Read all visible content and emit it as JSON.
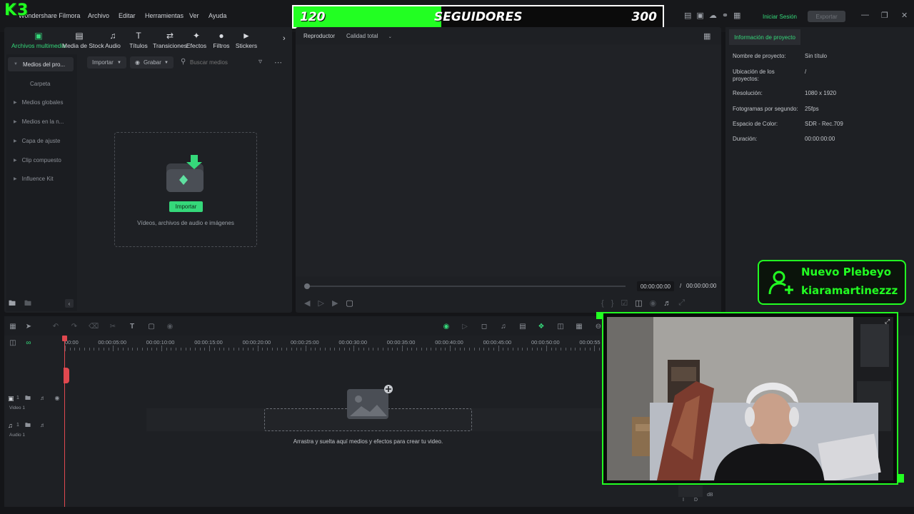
{
  "app": {
    "title": "Wondershare Filmora",
    "menu": [
      "Archivo",
      "Editar",
      "Herramientas",
      "Ver",
      "Ayuda"
    ],
    "login_label": "Iniciar Sesión",
    "export_label": "Exportar"
  },
  "overlay": {
    "logo_text": "K3",
    "followers_current": "120",
    "followers_label": "SEGUIDORES",
    "followers_goal": "300",
    "followers_progress": 0.4,
    "new_follower_title": "Nuevo Plebeyo",
    "new_follower_name": "kiaramartinezzz"
  },
  "media_tabs": [
    {
      "label": "Archivos multimedia",
      "icon": "media-icon"
    },
    {
      "label": "Media de Stock",
      "icon": "stock-icon"
    },
    {
      "label": "Audio",
      "icon": "audio-icon"
    },
    {
      "label": "Títulos",
      "icon": "titles-icon"
    },
    {
      "label": "Transiciones",
      "icon": "transitions-icon"
    },
    {
      "label": "Efectos",
      "icon": "effects-icon"
    },
    {
      "label": "Filtros",
      "icon": "filters-icon"
    },
    {
      "label": "Stickers",
      "icon": "stickers-icon"
    }
  ],
  "sidebar": {
    "items": [
      "Medios del pro...",
      "Carpeta",
      "Medios globales",
      "Medios en la n...",
      "Capa de ajuste",
      "Clip compuesto",
      "Influence Kit"
    ]
  },
  "library": {
    "import_label": "Importar",
    "record_label": "Grabar",
    "search_placeholder": "Buscar medios",
    "drop_button": "Importar",
    "drop_hint": "Vídeos, archivos de audio e imágenes"
  },
  "player": {
    "label": "Reproductor",
    "quality": "Calidad total",
    "current_time": "00:00:00:00",
    "separator": "/",
    "total_time": "00:00:00:00"
  },
  "project_info": {
    "tab": "Información de proyecto",
    "rows": [
      {
        "label": "Nombre de proyecto:",
        "value": "Sin título"
      },
      {
        "label": "Ubicación de los proyectos:",
        "value": "/"
      },
      {
        "label": "Resolución:",
        "value": "1080 x 1920"
      },
      {
        "label": "Fotogramas por segundo:",
        "value": "25fps"
      },
      {
        "label": "Espacio de Color:",
        "value": "SDR - Rec.709"
      },
      {
        "label": "Duración:",
        "value": "00:00:00:00"
      }
    ]
  },
  "timeline": {
    "ticks": [
      "00:00",
      "00:00:05:00",
      "00:00:10:00",
      "00:00:15:00",
      "00:00:20:00",
      "00:00:25:00",
      "00:00:30:00",
      "00:00:35:00",
      "00:00:40:00",
      "00:00:45:00",
      "00:00:50:00",
      "00:00:55"
    ],
    "video_track": "Video 1",
    "audio_track": "Audio 1",
    "video_num": "1",
    "audio_num": "1",
    "drop_hint": "Arrastra y suelta aquí medios y efectos para crear tu video.",
    "meter_unit": "dB",
    "meter_labels": [
      "I",
      "D"
    ]
  },
  "colors": {
    "accent": "#35d87a",
    "overlay_green": "#22ff22",
    "panel": "#1e2024"
  }
}
